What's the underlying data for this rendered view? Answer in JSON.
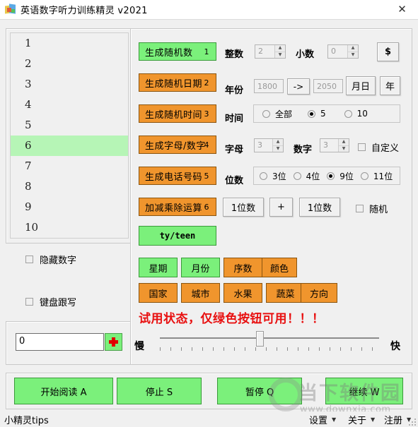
{
  "window": {
    "title": "英语数字听力训练精灵 v2021",
    "app_icon": "app-cube-icon",
    "close_label": "✕"
  },
  "list": {
    "items": [
      "1",
      "2",
      "3",
      "4",
      "5",
      "6",
      "7",
      "8",
      "9",
      "10"
    ],
    "selected_index": 5,
    "selected_value": "6"
  },
  "left_options": {
    "hide_numbers": {
      "label": "隐藏数字",
      "checked": false
    },
    "keyboard_follow": {
      "label": "键盘跟写",
      "checked": false
    }
  },
  "left_input": {
    "value": "0",
    "add_button_icon": "red-cross-icon"
  },
  "generators": [
    {
      "label": "生成随机数",
      "num": "1",
      "color": "green",
      "enabled": true
    },
    {
      "label": "生成随机日期",
      "num": "2",
      "color": "orange",
      "enabled": false
    },
    {
      "label": "生成随机时间",
      "num": "3",
      "color": "orange",
      "enabled": false
    },
    {
      "label": "生成字母/数字",
      "num": "4",
      "color": "orange",
      "enabled": false
    },
    {
      "label": "生成电话号码",
      "num": "5",
      "color": "orange",
      "enabled": false
    },
    {
      "label": "加减乘除运算",
      "num": "6",
      "color": "orange",
      "enabled": false
    }
  ],
  "tyteen_button": {
    "label": "ty/teen",
    "color": "green"
  },
  "row_number": {
    "integer_label": "整数",
    "integer_value": "2",
    "decimal_label": "小数",
    "decimal_value": "0",
    "dollar_button": "$"
  },
  "row_date": {
    "year_label": "年份",
    "year_from": "1800",
    "arrow_button": "->",
    "year_to": "2050",
    "monthday_button": "月日",
    "year_button": "年"
  },
  "row_time": {
    "label": "时间",
    "options": [
      {
        "label": "全部",
        "selected": false
      },
      {
        "label": "5",
        "selected": true
      },
      {
        "label": "10",
        "selected": false
      }
    ]
  },
  "row_letter": {
    "letter_label": "字母",
    "letter_value": "3",
    "digit_label": "数字",
    "digit_value": "3",
    "custom_label": "自定义",
    "custom_checked": false
  },
  "row_phone": {
    "label": "位数",
    "options": [
      {
        "label": "3位",
        "selected": false
      },
      {
        "label": "4位",
        "selected": false
      },
      {
        "label": "9位",
        "selected": true
      },
      {
        "label": "11位",
        "selected": false
      }
    ]
  },
  "row_math": {
    "left_operand": "1位数",
    "operator": "+",
    "right_operand": "1位数",
    "random_label": "随机",
    "random_checked": false
  },
  "categories": [
    {
      "label": "星期",
      "color": "green",
      "enabled": true
    },
    {
      "label": "月份",
      "color": "green",
      "enabled": true
    },
    {
      "label": "序数",
      "color": "orange",
      "enabled": false
    },
    {
      "label": "颜色",
      "color": "orange",
      "enabled": false
    },
    {
      "label": "国家",
      "color": "orange",
      "enabled": false
    },
    {
      "label": "城市",
      "color": "orange",
      "enabled": false
    },
    {
      "label": "水果",
      "color": "orange",
      "enabled": false
    },
    {
      "label": "蔬菜",
      "color": "orange",
      "enabled": false
    },
    {
      "label": "方向",
      "color": "orange",
      "enabled": false
    }
  ],
  "warning": {
    "text": "试用状态，仅绿色按钮可用！！！",
    "color": "#e81010"
  },
  "speed_slider": {
    "min_label": "慢",
    "max_label": "快",
    "tick_count": 21,
    "position_percent": 55
  },
  "playback": [
    {
      "label": "开始阅读 A"
    },
    {
      "label": "停止 S"
    },
    {
      "label": "暂停 Q"
    },
    {
      "label": "继续 W"
    }
  ],
  "statusbar": {
    "tips": "小精灵tips",
    "menus": [
      {
        "label": "设置"
      },
      {
        "label": "关于"
      },
      {
        "label": "注册"
      }
    ]
  },
  "watermark": {
    "text": "当下软件园",
    "url": "www.downxia.com"
  },
  "colors": {
    "green_fill": "#7bf07b",
    "green_border": "#3a9a3a",
    "orange_fill": "#f0952d",
    "orange_border": "#8a5510",
    "selection": "#b6f5b6",
    "warning": "#e81010",
    "window_bg": "#f0f0f0"
  }
}
